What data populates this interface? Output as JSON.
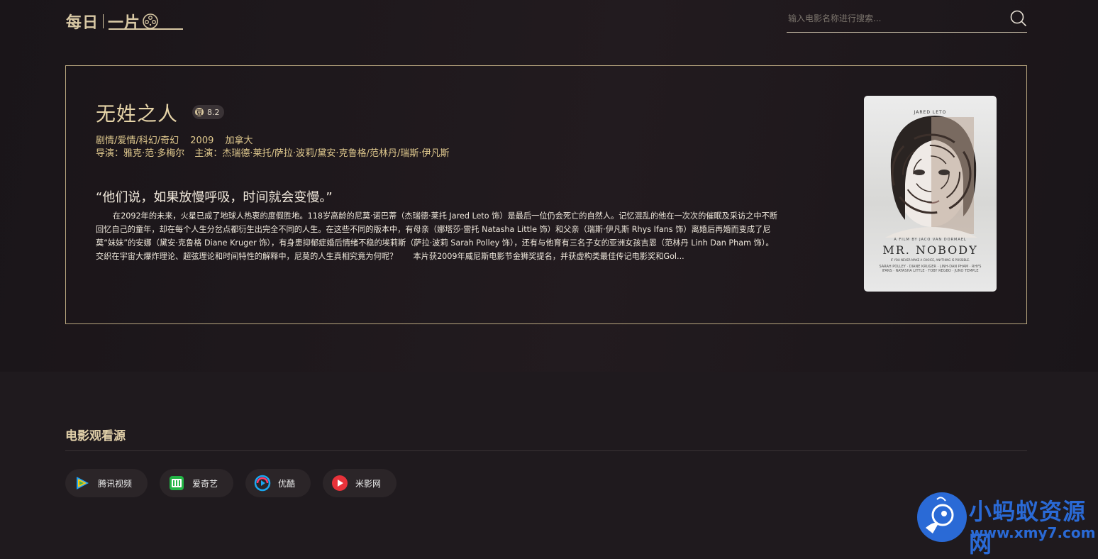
{
  "header": {
    "logo_part1": "每日",
    "logo_part2": "一片",
    "search_placeholder": "输入电影名称进行搜索..."
  },
  "movie": {
    "title": "无姓之人",
    "rating": "8.2",
    "rating_badge": "豆",
    "genres": "剧情/爱情/科幻/奇幻",
    "year": "2009",
    "country": "加拿大",
    "director": "导演：雅克·范·多梅尔",
    "cast": "主演：杰瑞德·莱托/萨拉·波莉/黛安·克鲁格/范林丹/瑞斯·伊凡斯",
    "quote": "“他们说，如果放慢呼吸，时间就会变慢。”",
    "synopsis": "在2092年的未来，火星已成了地球人热衷的度假胜地。118岁高龄的尼莫·诺巴蒂（杰瑞德·莱托 Jared Leto 饰）是最后一位仍会死亡的自然人。记忆混乱的他在一次次的催眠及采访之中不断回忆自己的童年，却在每个人生分岔点都衍生出完全不同的人生。在这些不同的版本中，有母亲（娜塔莎·雷托 Natasha Little 饰）和父亲（瑞斯·伊凡斯 Rhys Ifans 饰）离婚后再婚而变成了尼莫“妹妹”的安娜（黛安·克鲁格 Diane Kruger 饰），有身患抑郁症婚后情绪不稳的埃莉斯（萨拉·波莉 Sarah Polley 饰），还有与他育有三名子女的亚洲女孩吉恩（范林丹 Linh Dan Pham 饰）。交织在宇宙大爆炸理论、超弦理论和时间特性的解释中，尼莫的人生真相究竟为何呢？　　本片获2009年威尼斯电影节金狮奖提名，并获虚构类最佳传记电影奖和Gol...",
    "poster": {
      "actor": "JARED LETO",
      "tagline": "A FILM BY JACO VAN DORMAEL",
      "title": "MR. NOBODY",
      "subtitle": "IF YOU NEVER MAKE A CHOICE, ANYTHING IS POSSIBLE.",
      "credits": "SARAH POLLEY · DIANE KRUGER · LINH-DAN PHAM · RHYS IFANS · NATASHA LITTLE · TOBY REGBO · JUNO TEMPLE"
    }
  },
  "sources": {
    "title": "电影观看源",
    "items": [
      {
        "label": "腾讯视频",
        "icon": "tencent-video-icon"
      },
      {
        "label": "爱奇艺",
        "icon": "iqiyi-icon"
      },
      {
        "label": "优酷",
        "icon": "youku-icon"
      },
      {
        "label": "米影网",
        "icon": "miying-icon"
      }
    ]
  },
  "watermark": {
    "line1": "小蚂蚁资源网",
    "line2": "www.xmy7.com"
  },
  "colors": {
    "accent_gold": "#e0c98e",
    "background": "#1f1a1e",
    "card_border": "#b8a67f",
    "watermark_blue": "#2a6ad6"
  }
}
